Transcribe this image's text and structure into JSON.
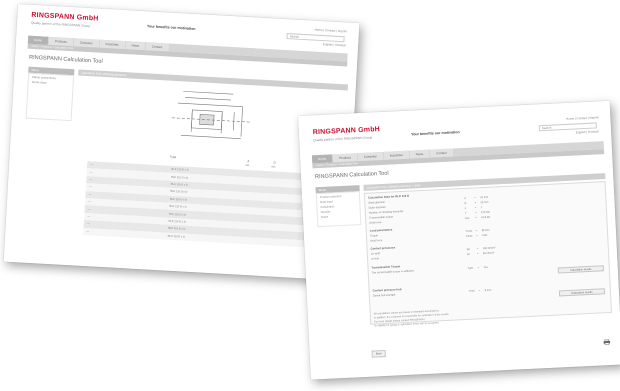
{
  "brand": {
    "name": "RINGSPANN GmbH",
    "sub": "Quality partner of the RINGSPANN Group",
    "motto": "Your benefits our motivation"
  },
  "header": {
    "links": "Home | Contact | Imprint",
    "search_label": "Search",
    "lang": "English | Deutsch"
  },
  "nav": {
    "tabs": [
      "Home",
      "Products",
      "Company",
      "Industries",
      "News",
      "Contact"
    ],
    "subnav": "Home > Products > Calculation Tool"
  },
  "page_title": "RINGSPANN Calculation Tool",
  "sheet1": {
    "sidebar_head": "Menu",
    "sidebar_items": [
      "Clamp connections",
      "Shrink discs",
      "",
      ""
    ],
    "main_head": "Calculation Tool: Clamping elements",
    "col_type": "Type",
    "col_a": "d",
    "col_b": "D",
    "unit_a": "mm",
    "unit_b": "mm",
    "rows": [
      {
        "a": "—",
        "b": "RLK 110 D x D"
      },
      {
        "a": "—",
        "b": "RLK 110 D x D"
      },
      {
        "a": "—",
        "b": "RLK 110 D x D"
      },
      {
        "a": "—",
        "b": "RLK 110 D x D"
      },
      {
        "a": "—",
        "b": "RLK 110 D x D"
      },
      {
        "a": "—",
        "b": "RLK 110 D x D"
      },
      {
        "a": "—",
        "b": "RLK 110 D x D"
      },
      {
        "a": "—",
        "b": "RLK 110 D x D"
      },
      {
        "a": "—",
        "b": "RLK 110 D x D"
      },
      {
        "a": "—",
        "b": "RLK 110 D x D"
      }
    ]
  },
  "sheet2": {
    "sidebar_head": "Menu",
    "sidebar_items": [
      "Product selection",
      "Data input",
      "Calculation",
      "Results",
      "Notes"
    ],
    "main_head": "Calculation Tool: Clamping element — Input",
    "section1": "Calculation Data for RLK 110 D",
    "rows1": [
      {
        "lbl": "Shaft diameter",
        "sym": "d",
        "val": "25 mm"
      },
      {
        "lbl": "Outer diameter",
        "sym": "D",
        "val": "55 mm"
      },
      {
        "lbl": "Number of clamping elements",
        "sym": "n",
        "val": "1"
      },
      {
        "lbl": "Transmissible torque",
        "sym": "T",
        "val": "210 Nm"
      },
      {
        "lbl": "Axial force",
        "sym": "Fax",
        "val": "16.8 kN"
      }
    ],
    "section2": "Load parameters",
    "rows2": [
      {
        "lbl": "Torque",
        "sym": "Tmax",
        "val": "85 Nm"
      },
      {
        "lbl": "Axial force",
        "sym": "Fmax",
        "val": "0 kN"
      }
    ],
    "section3": "Contact pressures",
    "rows3": [
      {
        "lbl": "on shaft",
        "sym": "pw",
        "val": "184 N/mm²"
      },
      {
        "lbl": "on hub",
        "sym": "pn",
        "val": "84 N/mm²"
      }
    ],
    "section4": "Transmissible Torque",
    "row4": {
      "lbl": "The transmissible torque is sufficient",
      "sym": "Tges",
      "val": "Yes"
    },
    "btn1": "Calculation results",
    "section5": "Contact pressure hub",
    "row5": {
      "lbl": "Check hub strength",
      "sym": "Tmin",
      "val": "8 mm"
    },
    "btn2": "Calculation results",
    "notes": [
      "All calculations values are based on standard assumptions.",
      "In addition, the customer is responsible for verification of the results.",
      "For more details please contact RINGSPANN.",
      "No liability for typing or calculation errors can be accepted."
    ],
    "back_label": "Back"
  }
}
